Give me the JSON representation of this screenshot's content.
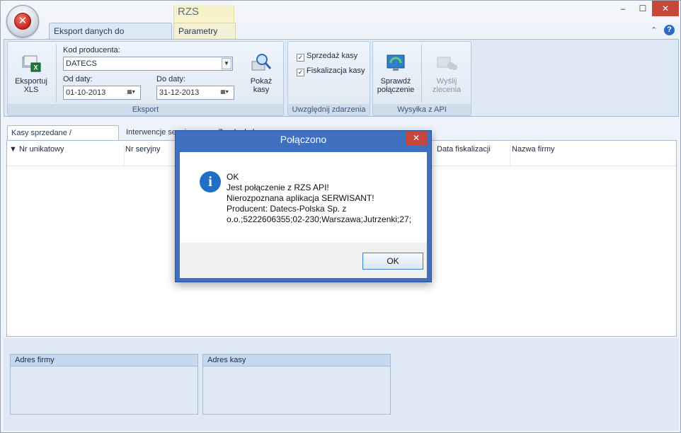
{
  "app": {
    "title": "RZS"
  },
  "window_controls": {
    "minimize": "‒",
    "maximize": "☐",
    "close": "✕"
  },
  "ribbon": {
    "tabs": [
      {
        "label": "Eksport danych do producenta",
        "active": true
      },
      {
        "label": "Parametry API",
        "active": false
      }
    ],
    "groups": {
      "eksport": {
        "caption": "Eksport",
        "export_xls": {
          "line1": "Eksportuj",
          "line2": "XLS"
        },
        "producer_code": {
          "label": "Kod producenta:",
          "value": "DATECS"
        },
        "date_from": {
          "label": "Od daty:",
          "value": "01-10-2013"
        },
        "date_to": {
          "label": "Do daty:",
          "value": "31-12-2013"
        },
        "show_cash": {
          "line1": "Pokaż",
          "line2": "kasy"
        }
      },
      "events": {
        "caption": "Uwzględnij zdarzenia",
        "sales": {
          "label": "Sprzedaż kasy",
          "checked": true
        },
        "fiscal": {
          "label": "Fiskalizacja kasy",
          "checked": true
        }
      },
      "api": {
        "caption": "Wysyłka z API",
        "check_connection": {
          "line1": "Sprawdź",
          "line2": "połączenie"
        },
        "send_orders": {
          "line1": "Wyślij",
          "line2": "zlecenia",
          "disabled": true
        }
      }
    }
  },
  "main_tabs": [
    {
      "label": "Kasy sprzedane / ufiskalnione",
      "active": true
    },
    {
      "label": "Interwencje serwisowe",
      "active": false
    },
    {
      "label": "Zgody do kasy",
      "active": false
    }
  ],
  "grid": {
    "columns": [
      "Nr unikatowy",
      "Nr seryjny",
      "Data fiskalizacji",
      "Nazwa firmy"
    ]
  },
  "panels": {
    "company_address": "Adres firmy",
    "cash_address": "Adres kasy"
  },
  "dialog": {
    "title": "Połączono",
    "lines": [
      "OK",
      "Jest połączenie z RZS API!",
      "Nierozpoznana aplikacja SERWISANT!",
      "Producent: Datecs-Polska Sp. z",
      "o.o.;5222606355;02-230;Warszawa;Jutrzenki;27;"
    ],
    "ok_label": "OK"
  },
  "colors": {
    "dialog_frame": "#3f6fbf",
    "close_red": "#c7473d",
    "ribbon_bg": "#dfe9f5"
  }
}
